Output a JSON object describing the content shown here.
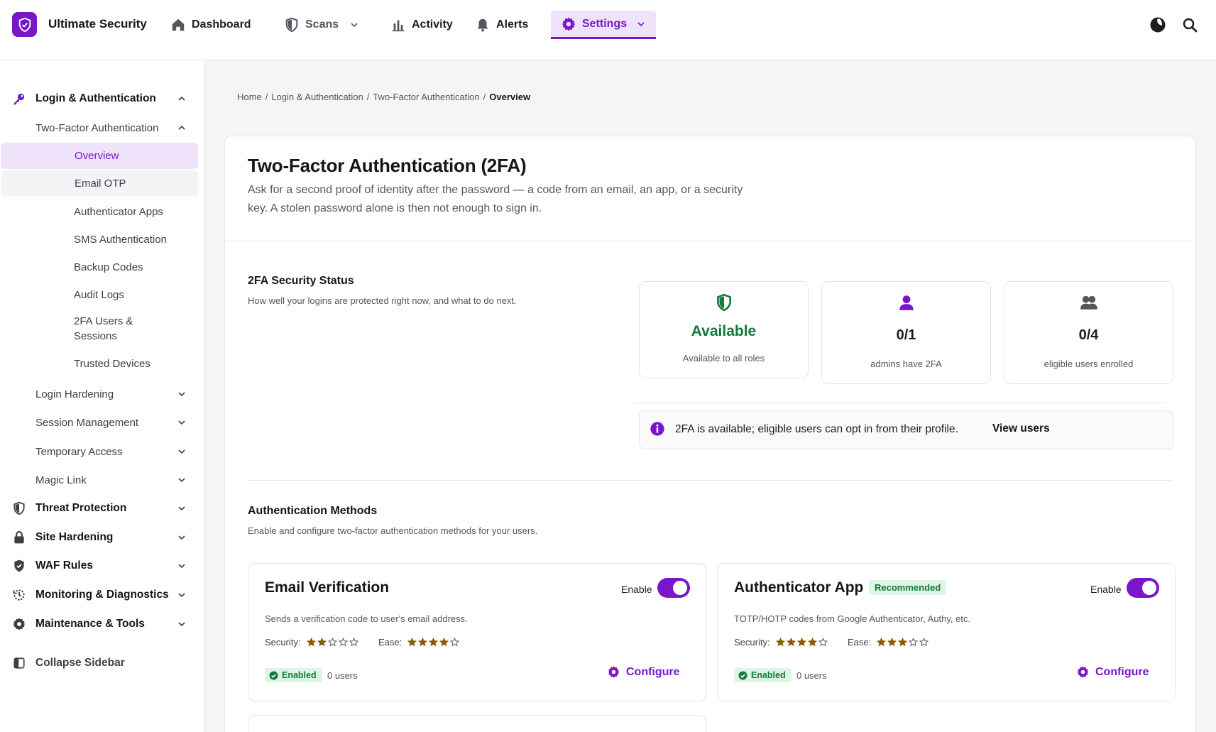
{
  "app": {
    "title": "Ultimate Security"
  },
  "nav": {
    "dashboard": "Dashboard",
    "scans": "Scans",
    "activity": "Activity",
    "alerts": "Alerts",
    "settings": "Settings"
  },
  "sidebar": {
    "login_auth": "Login & Authentication",
    "two_factor": "Two-Factor Authentication",
    "leaves": [
      "Overview",
      "Email OTP",
      "Authenticator Apps",
      "SMS Authentication",
      "Backup Codes",
      "Audit Logs",
      "2FA Users & Sessions",
      "Trusted Devices"
    ],
    "subs": [
      "Login Hardening",
      "Session Management",
      "Temporary Access",
      "Magic Link"
    ],
    "top": [
      "Threat Protection",
      "Site Hardening",
      "WAF Rules",
      "Monitoring & Diagnostics",
      "Maintenance & Tools"
    ],
    "collapse": "Collapse Sidebar"
  },
  "breadcrumb": [
    "Home",
    "/",
    "Login & Authentication",
    "/",
    "Two-Factor Authentication",
    "/",
    "Overview"
  ],
  "page": {
    "title": "Two-Factor Authentication (2FA)",
    "description": "Ask for a second proof of identity after the password — a code from an email, an app, or a security key. A stolen password alone is then not enough to sign in."
  },
  "status_section": {
    "title": "2FA Security Status",
    "description": "How well your logins are protected right now, and what to do next.",
    "stats": [
      {
        "value": "Available",
        "label": "Available to all roles",
        "color": "#137a3a",
        "icon": "shield-icon"
      },
      {
        "value": "0/1",
        "label": "admins have 2FA",
        "color": "#16161a",
        "icon": "user-icon"
      },
      {
        "value": "0/4",
        "label": "eligible users enrolled",
        "color": "#16161a",
        "icon": "users-icon"
      }
    ],
    "info": "2FA is available; eligible users can opt in from their profile.",
    "info_link": "View users"
  },
  "methods_section": {
    "title": "Authentication Methods",
    "description": "Enable and configure two-factor authentication methods for your users.",
    "security_label": "Security:",
    "ease_label": "Ease:",
    "enable_label": "Enable",
    "configure_label": "Configure",
    "methods": [
      {
        "title": "Email Verification",
        "badge": "",
        "description": "Sends a verification code to user's email address.",
        "security": 2,
        "ease": 4,
        "status": "Enabled",
        "users": "0 users",
        "enabled": true
      },
      {
        "title": "Authenticator App",
        "badge": "Recommended",
        "description": "TOTP/HOTP codes from Google Authenticator, Authy, etc.",
        "security": 4,
        "ease": 3,
        "status": "Enabled",
        "users": "0 users",
        "enabled": true
      }
    ]
  },
  "colors": {
    "accent": "#7a16c9",
    "success": "#137a3a",
    "star": "#8a5a00"
  }
}
